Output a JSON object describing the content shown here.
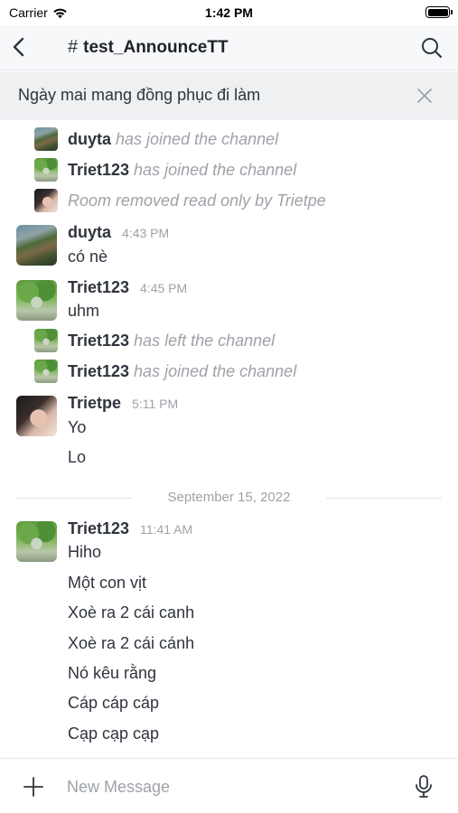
{
  "status_bar": {
    "carrier": "Carrier",
    "time": "1:42 PM"
  },
  "header": {
    "hash": "#",
    "title": "test_AnnounceTT"
  },
  "announcement": {
    "text": "Ngày mai mang đồng phục đi làm"
  },
  "messages": {
    "sys1": {
      "user": "duyta",
      "text": "has joined the channel"
    },
    "sys2": {
      "user": "Triet123",
      "text": "has joined the channel"
    },
    "sys3": {
      "text": "Room removed read only by Trietpe"
    },
    "m1": {
      "user": "duyta",
      "time": "4:43 PM",
      "lines": [
        "có nè"
      ]
    },
    "m2": {
      "user": "Triet123",
      "time": "4:45 PM",
      "lines": [
        "uhm"
      ]
    },
    "sys4": {
      "user": "Triet123",
      "text": "has left the channel"
    },
    "sys5": {
      "user": "Triet123",
      "text": "has joined the channel"
    },
    "m3": {
      "user": "Trietpe",
      "time": "5:11 PM",
      "lines": [
        "Yo",
        "Lo"
      ]
    },
    "date_divider": "September 15, 2022",
    "m4": {
      "user": "Triet123",
      "time": "11:41 AM",
      "lines": [
        "Hiho",
        "Một con vịt",
        "Xoè ra 2 cái canh",
        "Xoè ra 2 cái cánh",
        "Nó kêu rằng",
        "Cáp cáp cáp",
        "Cạp cạp cạp"
      ]
    }
  },
  "composer": {
    "placeholder": "New Message"
  },
  "icons": {
    "back": "chevron-left-icon",
    "search": "search-icon",
    "close": "close-icon",
    "add": "plus-icon",
    "mic": "microphone-icon",
    "wifi": "wifi-icon",
    "battery": "battery-icon"
  },
  "colors": {
    "text": "#2f343d",
    "muted": "#9ea2a8",
    "header_bg": "#f7f8fa",
    "announce_bg": "#eef0f2"
  }
}
